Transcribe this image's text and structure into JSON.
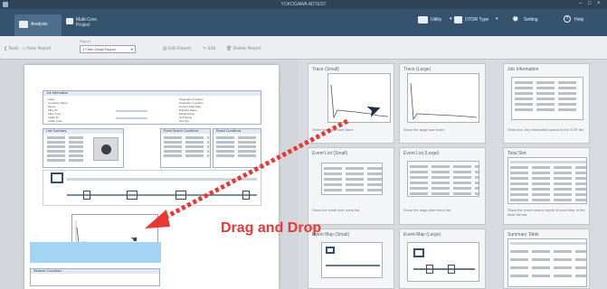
{
  "window": {
    "title": "YOKOGAWA ADTEST",
    "controls": [
      "–",
      "□",
      "×"
    ]
  },
  "ribbon": {
    "tabs": [
      {
        "label": "Analysis",
        "active": true
      },
      {
        "label": "Multi-Core Project",
        "active": false
      }
    ],
    "menus": [
      {
        "label": "Utility",
        "icon": "utility-icon"
      },
      {
        "label": "OTDR Type",
        "icon": "otdr-type-icon"
      },
      {
        "label": "Setting",
        "icon": "gear-icon"
      },
      {
        "label": "Help",
        "icon": "help-icon"
      }
    ]
  },
  "toolbar": {
    "back_label": "Back",
    "new_report_label": "New Report",
    "report_field_label": "Report",
    "report_value": "1 Fiber Detail Report",
    "buttons": [
      "Edit Report",
      "Edit",
      "Delete Report"
    ]
  },
  "report": {
    "sections": {
      "job_information": "Job Information",
      "link_summary": "Link Summary",
      "event_search": "Event Search Conditions",
      "results": "Result Conditions",
      "measure": "Measure Conditions"
    },
    "job_fields": [
      "Label",
      "Company Name",
      "Name",
      "Fiber ID",
      "Fiber Type",
      "Cable ID",
      "Cable Code"
    ],
    "job_fields_right": [
      "Origination Location",
      "Origination Location",
      "Current Data Flag",
      "Supplier Name",
      "Model Name",
      "Unit Name",
      "Set Unit"
    ]
  },
  "cards": [
    {
      "title": "Trace (Small)",
      "desc": "Show the small size trace."
    },
    {
      "title": "Trace (Large)",
      "desc": "Show the large size trace."
    },
    {
      "title": "Job Information",
      "desc": "Show the Job information saved in the SOR file."
    },
    {
      "title": "Event List (Small)",
      "desc": "Show the small size event list."
    },
    {
      "title": "Event List (Large)",
      "desc": "Show the large size event list."
    },
    {
      "title": "Total Slot",
      "desc": "Show the event search result of each fiber in the table format."
    },
    {
      "title": "Event Map (Small)",
      "desc": ""
    },
    {
      "title": "Event Map (Large)",
      "desc": ""
    },
    {
      "title": "Summary Table",
      "desc": ""
    }
  ],
  "overlay": {
    "label": "Drag and Drop",
    "color": "#e53935"
  }
}
